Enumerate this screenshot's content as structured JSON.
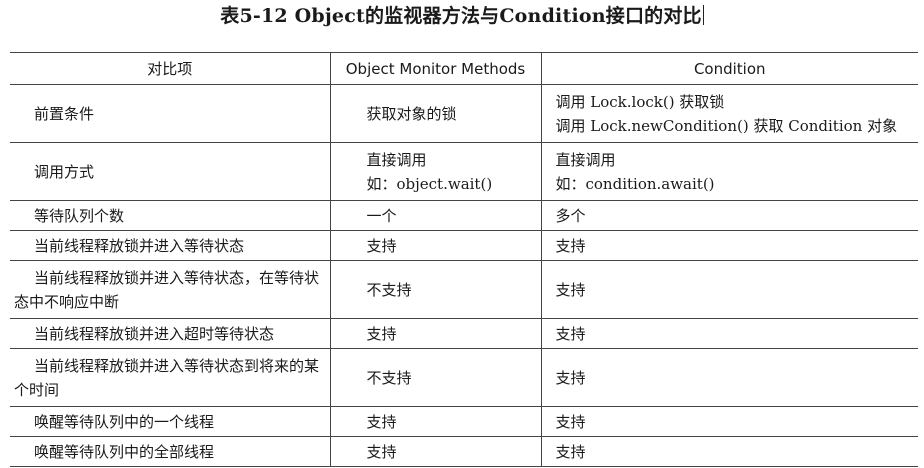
{
  "title": "表5-12  Object的监视器方法与Condition接口的对比",
  "table": {
    "headers": [
      "对比项",
      "Object Monitor Methods",
      "Condition"
    ],
    "rows": [
      {
        "item": "前置条件",
        "object": [
          "获取对象的锁"
        ],
        "condition": [
          "调用 Lock.lock() 获取锁",
          "调用 Lock.newCondition() 获取 Condition 对象"
        ]
      },
      {
        "item": "调用方式",
        "object": [
          "直接调用",
          "如：object.wait()"
        ],
        "condition": [
          "直接调用",
          "如：condition.await()"
        ]
      },
      {
        "item": "等待队列个数",
        "object": [
          "一个"
        ],
        "condition": [
          "多个"
        ]
      },
      {
        "item": "当前线程释放锁并进入等待状态",
        "object": [
          "支持"
        ],
        "condition": [
          "支持"
        ]
      },
      {
        "item": "当前线程释放锁并进入等待状态，在等待状态中不响应中断",
        "object": [
          "不支持"
        ],
        "condition": [
          "支持"
        ]
      },
      {
        "item": "当前线程释放锁并进入超时等待状态",
        "object": [
          "支持"
        ],
        "condition": [
          "支持"
        ]
      },
      {
        "item": "当前线程释放锁并进入等待状态到将来的某个时间",
        "object": [
          "不支持"
        ],
        "condition": [
          "支持"
        ]
      },
      {
        "item": "唤醒等待队列中的一个线程",
        "object": [
          "支持"
        ],
        "condition": [
          "支持"
        ]
      },
      {
        "item": "唤醒等待队列中的全部线程",
        "object": [
          "支持"
        ],
        "condition": [
          "支持"
        ]
      }
    ]
  }
}
